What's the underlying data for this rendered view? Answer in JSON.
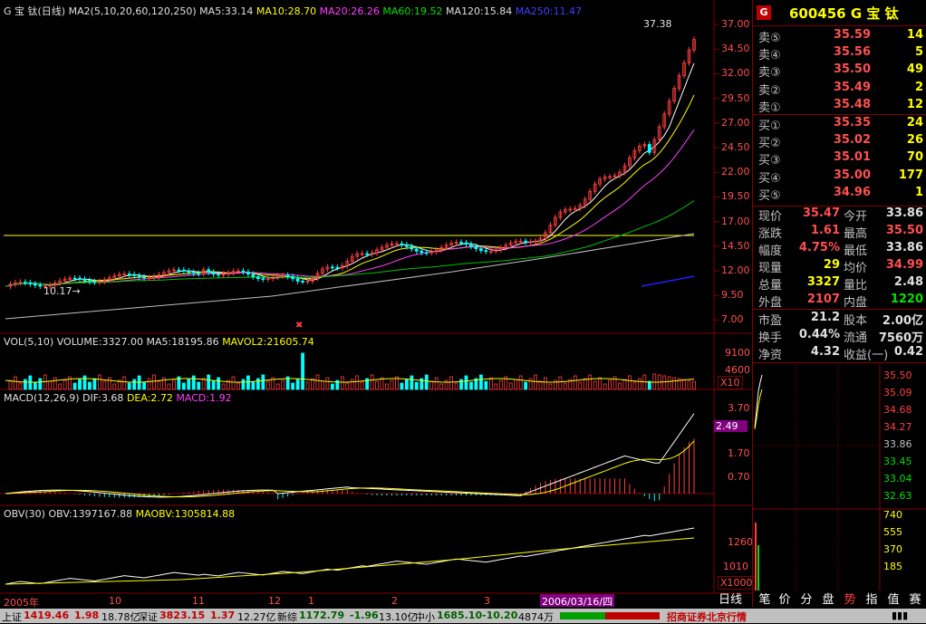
{
  "stock": {
    "code": "600456",
    "name": "G 宝  钛",
    "logo": "G"
  },
  "main_header": {
    "title": "G 宝  钛(日线)",
    "ma_label": "MA2(5,10,20,60,120,250)",
    "ma5": "MA5:33.14",
    "ma10": "MA10:28.70",
    "ma20": "MA20:26.26",
    "ma60": "MA60:19.52",
    "ma120": "MA120:15.84",
    "ma250": "MA250:11.47"
  },
  "price_axis": [
    "37.00",
    "34.50",
    "32.00",
    "29.50",
    "27.00",
    "24.50",
    "22.00",
    "19.50",
    "17.00",
    "14.50",
    "12.00",
    "9.50",
    "7.00"
  ],
  "annotations": {
    "high": "37.38",
    "low": "10.17→"
  },
  "vol_header": {
    "title": "VOL(5,10)",
    "volume": "VOLUME:3327.00",
    "ma5": "MA5:18195.86",
    "mavol2": "MAVOL2:21605.74"
  },
  "vol_axis": [
    "9100",
    "4600",
    "X10"
  ],
  "macd_header": {
    "title": "MACD(12,26,9)",
    "dif": "DIF:3.68",
    "dea": "DEA:2.72",
    "macd": "MACD:1.92"
  },
  "macd_axis": [
    "3.70",
    "2.49",
    "1.70",
    "0.70"
  ],
  "obv_header": {
    "title": "OBV(30)",
    "obv": "OBV:1397167.88",
    "maobv": "MAOBV:1305814.88"
  },
  "obv_axis": [
    "1260",
    "1010",
    "X1000"
  ],
  "time_axis": [
    "2005年",
    "10",
    "11",
    "12",
    "1",
    "2",
    "3"
  ],
  "cursor_date": "2006/03/16/四",
  "order_book": {
    "sell": [
      {
        "label": "卖⑤",
        "price": "35.59",
        "vol": "14"
      },
      {
        "label": "卖④",
        "price": "35.56",
        "vol": "5"
      },
      {
        "label": "卖③",
        "price": "35.50",
        "vol": "49"
      },
      {
        "label": "卖②",
        "price": "35.49",
        "vol": "2"
      },
      {
        "label": "卖①",
        "price": "35.48",
        "vol": "12"
      }
    ],
    "buy": [
      {
        "label": "买①",
        "price": "35.35",
        "vol": "24"
      },
      {
        "label": "买②",
        "price": "35.02",
        "vol": "26"
      },
      {
        "label": "买③",
        "price": "35.01",
        "vol": "70"
      },
      {
        "label": "买④",
        "price": "35.00",
        "vol": "177"
      },
      {
        "label": "买⑤",
        "price": "34.96",
        "vol": "1"
      }
    ]
  },
  "stats": [
    {
      "l1": "现价",
      "v1": "35.47",
      "l2": "今开",
      "v2": "33.86"
    },
    {
      "l1": "涨跌",
      "v1": "1.61",
      "l2": "最高",
      "v2": "35.50"
    },
    {
      "l1": "幅度",
      "v1": "4.75%",
      "l2": "最低",
      "v2": "33.86"
    },
    {
      "l1": "现量",
      "v1": "29",
      "l2": "均价",
      "v2": "34.99"
    },
    {
      "l1": "总量",
      "v1": "3327",
      "l2": "量比",
      "v2": "2.48"
    },
    {
      "l1": "外盘",
      "v1": "2107",
      "l2": "内盘",
      "v2": "1220"
    }
  ],
  "stats2": [
    {
      "l1": "市盈",
      "v1": "21.2",
      "l2": "股本",
      "v2": "2.00亿"
    },
    {
      "l1": "换手",
      "v1": "0.44%",
      "l2": "流通",
      "v2": "7560万"
    },
    {
      "l1": "净资",
      "v1": "4.32",
      "l2": "收益(一)",
      "v2": "0.42"
    }
  ],
  "mini_price_axis": [
    "35.50",
    "35.09",
    "34.68",
    "34.27",
    "33.86",
    "33.45",
    "33.04",
    "32.63"
  ],
  "mini_vol_axis": [
    "740",
    "555",
    "370",
    "185"
  ],
  "tabs": [
    "日线",
    "笔",
    "价",
    "分",
    "盘",
    "势",
    "指",
    "值",
    "赛"
  ],
  "status_bar": {
    "sh_label": "上证",
    "sh_val": "1419.46",
    "sh_chg": "1.98",
    "sh_amt": "18.78亿",
    "sz_label": "深证",
    "sz_val": "3823.15",
    "sz_chg": "1.37",
    "sz_amt": "12.27亿",
    "xz_label": "新综",
    "xz_val": "1172.79",
    "xz_chg": "-1.96",
    "xz_amt": "13.10亿",
    "zx_label": "中小",
    "zx_val": "1685.10",
    "zx_chg": "-10.20",
    "zx_amt": "4874万",
    "broker": "招商证券北京行情"
  }
}
